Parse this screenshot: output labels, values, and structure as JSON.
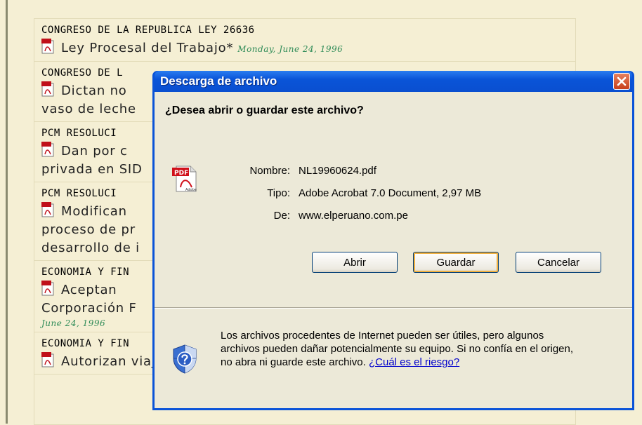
{
  "entries": [
    {
      "heading": "CONGRESO DE LA REPUBLICA  LEY  26636",
      "lines": [
        "Ley Procesal del Trabajo*"
      ],
      "date": "Monday, June 24, 1996"
    },
    {
      "heading": "CONGRESO DE L",
      "lines": [
        "Dictan no",
        "vaso de leche"
      ]
    },
    {
      "heading": "PCM  RESOLUCI",
      "lines": [
        "Dan por c",
        "privada en SID"
      ]
    },
    {
      "heading": "PCM  RESOLUCI",
      "lines": [
        "Modifican",
        "proceso de pr",
        "desarrollo de i"
      ]
    },
    {
      "heading": "ECONOMIA Y FIN",
      "lines": [
        "Aceptan",
        "Corporación F"
      ],
      "date": "June 24, 1996"
    },
    {
      "heading": "ECONOMIA Y FIN",
      "lines": [
        "Autorizan viaje de funcionaria del Ministerio para que participe"
      ]
    }
  ],
  "dialog": {
    "title": "Descarga de archivo",
    "question": "¿Desea abrir o guardar este archivo?",
    "name_label": "Nombre:",
    "name_value": "NL19960624.pdf",
    "type_label": "Tipo:",
    "type_value": "Adobe Acrobat 7.0 Document, 2,97 MB",
    "from_label": "De:",
    "from_value": "www.elperuano.com.pe",
    "buttons": {
      "open": "Abrir",
      "save": "Guardar",
      "cancel": "Cancelar"
    },
    "warning_text": "Los archivos procedentes de Internet pueden ser útiles, pero algunos archivos pueden dañar potencialmente su equipo. Si no confía en el origen, no abra ni guarde este archivo.",
    "risk_link": "¿Cuál es el riesgo?"
  },
  "colors": {
    "page_bg": "#f5efd4",
    "date": "#2e8b57",
    "titlebar": "#0a53d8",
    "dialog_bg": "#ece9d8",
    "link": "#0000cc"
  },
  "icons": {
    "pdf": "pdf-file-icon",
    "close": "close-icon",
    "shield": "security-shield-icon"
  },
  "pdf_icon_text": "PDF",
  "pdf_icon_brand": "Adobe"
}
